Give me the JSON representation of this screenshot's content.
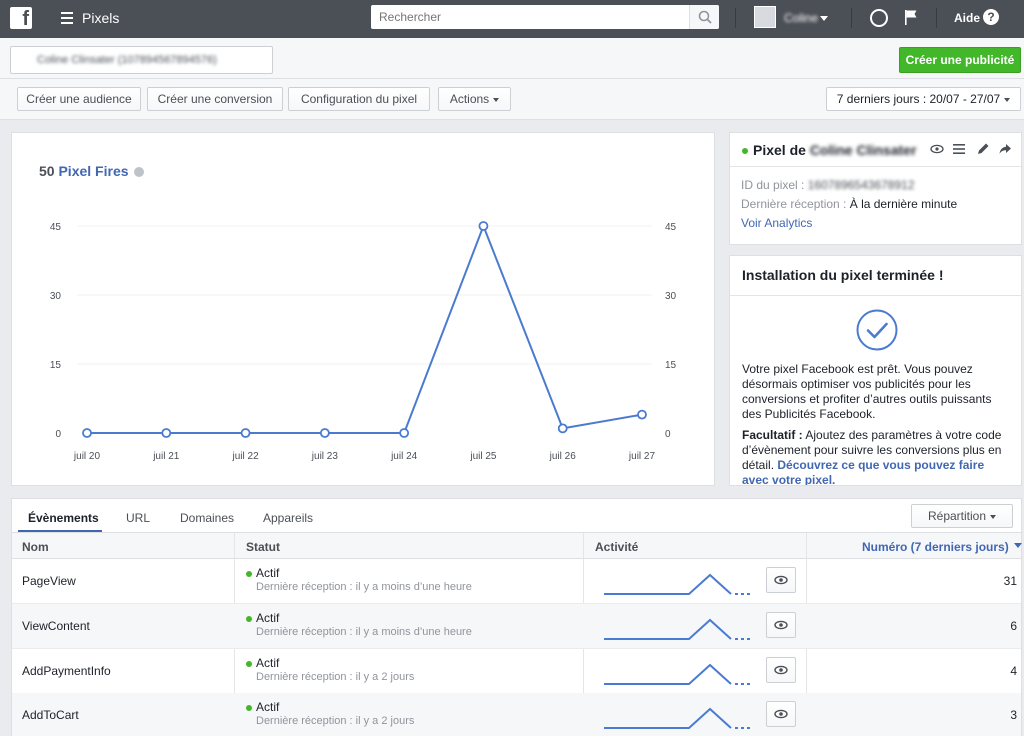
{
  "topbar": {
    "logo": "f",
    "app_title": "Pixels",
    "search_placeholder": "Rechercher",
    "user_name": "Coline",
    "help_label": "Aide",
    "help_icon_glyph": "?"
  },
  "header": {
    "account_label": "Coline Clinsater (107894567894576)",
    "create_ad_button": "Créer une publicité",
    "toolbar": {
      "create_audience": "Créer une audience",
      "create_conversion": "Créer une conversion",
      "pixel_config": "Configuration du pixel",
      "actions": "Actions"
    },
    "date_range": "7 derniers jours : 20/07 - 27/07"
  },
  "chart_data": {
    "type": "line",
    "title_count": "50",
    "title": "Pixel Fires",
    "categories": [
      "juil 20",
      "juil 21",
      "juil 22",
      "juil 23",
      "juil 24",
      "juil 25",
      "juil 26",
      "juil 27"
    ],
    "values": [
      0,
      0,
      0,
      0,
      0,
      45,
      1,
      4
    ],
    "yticks": [
      "0",
      "15",
      "30",
      "45"
    ],
    "ylim": [
      0,
      45
    ],
    "line_color": "#4a7bd0",
    "grid": true
  },
  "pixel_card": {
    "title_prefix": "Pixel de",
    "title_name": "Coline Clinsater",
    "id_label": "ID du pixel :",
    "id_value": "1607896543678912",
    "last_received_label": "Dernière réception :",
    "last_received_value": "À la dernière minute",
    "analytics_link": "Voir Analytics"
  },
  "install_card": {
    "title": "Installation du pixel terminée !",
    "body": "Votre pixel Facebook est prêt. Vous pouvez désormais optimiser vos publicités pour les conversions et profiter d’autres outils puissants des Publicités Facebook.",
    "optional_label": "Facultatif :",
    "optional_text": "Ajoutez des paramètres à votre code d’évènement pour suivre les conversions plus en détail.",
    "optional_link": "Découvrez ce que vous pouvez faire avec votre pixel."
  },
  "tabs": {
    "items": [
      "Évènements",
      "URL",
      "Domaines",
      "Appareils"
    ],
    "repartition": "Répartition"
  },
  "table": {
    "headers": {
      "name": "Nom",
      "status": "Statut",
      "activity": "Activité",
      "count": "Numéro (7 derniers jours)"
    },
    "rows": [
      {
        "name": "PageView",
        "status": "Actif",
        "detail": "Dernière réception : il y a moins d’une heure",
        "count": "31"
      },
      {
        "name": "ViewContent",
        "status": "Actif",
        "detail": "Dernière réception : il y a moins d’une heure",
        "count": "6"
      },
      {
        "name": "AddPaymentInfo",
        "status": "Actif",
        "detail": "Dernière réception : il y a 2 jours",
        "count": "4"
      },
      {
        "name": "AddToCart",
        "status": "Actif",
        "detail": "Dernière réception : il y a 2 jours",
        "count": "3"
      }
    ]
  },
  "colors": {
    "topbar": "#4b4f56",
    "accent": "#4267b2",
    "green": "#42b72a"
  }
}
